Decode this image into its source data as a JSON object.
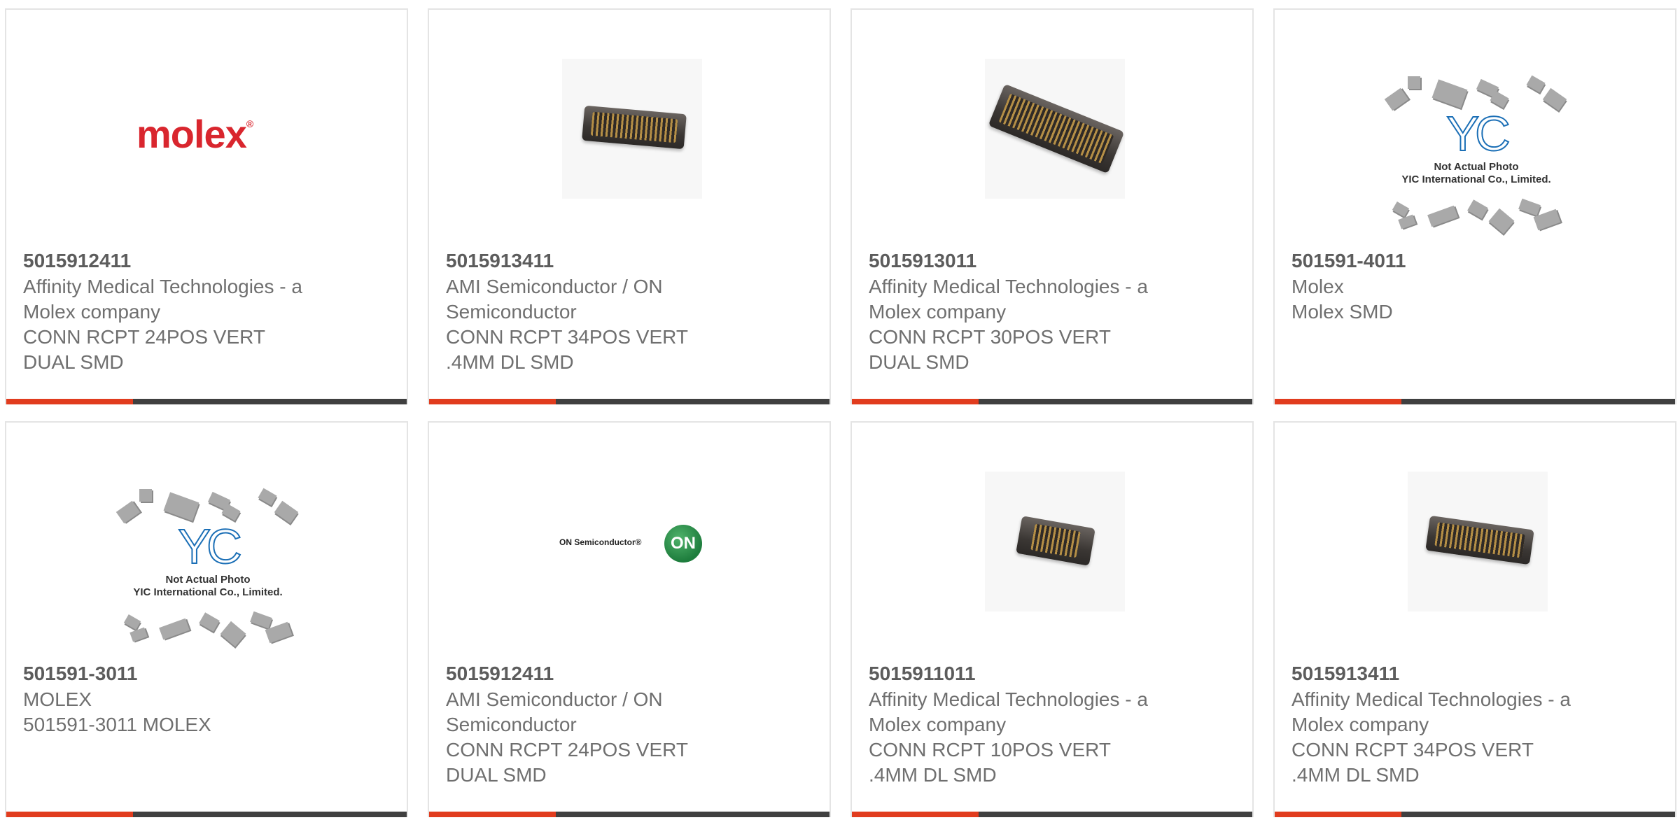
{
  "products": [
    {
      "part_number": "5015912411",
      "lines": [
        "Affinity Medical Technologies - a",
        "Molex company",
        "CONN RCPT 24POS VERT",
        "DUAL SMD"
      ],
      "image": "molex-logo",
      "logo_text": "molex",
      "logo_mark": "®"
    },
    {
      "part_number": "5015913411",
      "lines": [
        "AMI Semiconductor / ON",
        "Semiconductor",
        "CONN RCPT 34POS VERT",
        ".4MM DL SMD"
      ],
      "image": "connector-photo"
    },
    {
      "part_number": "5015913011",
      "lines": [
        "Affinity Medical Technologies - a",
        "Molex company",
        "CONN RCPT 30POS VERT",
        "DUAL SMD"
      ],
      "image": "connector-photo"
    },
    {
      "part_number": "501591-4011",
      "lines": [
        "Molex",
        "Molex SMD"
      ],
      "image": "yic-placeholder",
      "placeholder_caption_1": "Not Actual Photo",
      "placeholder_caption_2": "YIC International Co., Limited."
    },
    {
      "part_number": "501591-3011",
      "lines": [
        "MOLEX",
        "501591-3011 MOLEX"
      ],
      "image": "yic-placeholder",
      "placeholder_caption_1": "Not Actual Photo",
      "placeholder_caption_2": "YIC International Co., Limited."
    },
    {
      "part_number": "5015912411",
      "lines": [
        "AMI Semiconductor / ON",
        "Semiconductor",
        "CONN RCPT 24POS VERT",
        "DUAL SMD"
      ],
      "image": "onsemi-logo",
      "logo_text": "ON Semiconductor®",
      "logo_badge": "ON"
    },
    {
      "part_number": "5015911011",
      "lines": [
        "Affinity Medical Technologies - a",
        "Molex company",
        "CONN RCPT 10POS VERT",
        ".4MM DL SMD"
      ],
      "image": "connector-photo"
    },
    {
      "part_number": "5015913411",
      "lines": [
        "Affinity Medical Technologies - a",
        "Molex company",
        "CONN RCPT 34POS VERT",
        ".4MM DL SMD"
      ],
      "image": "connector-photo"
    }
  ],
  "colors": {
    "accent": "#e13c1e",
    "bar": "#404040",
    "border": "#e4e4e4",
    "text": "#6f6f6f"
  }
}
